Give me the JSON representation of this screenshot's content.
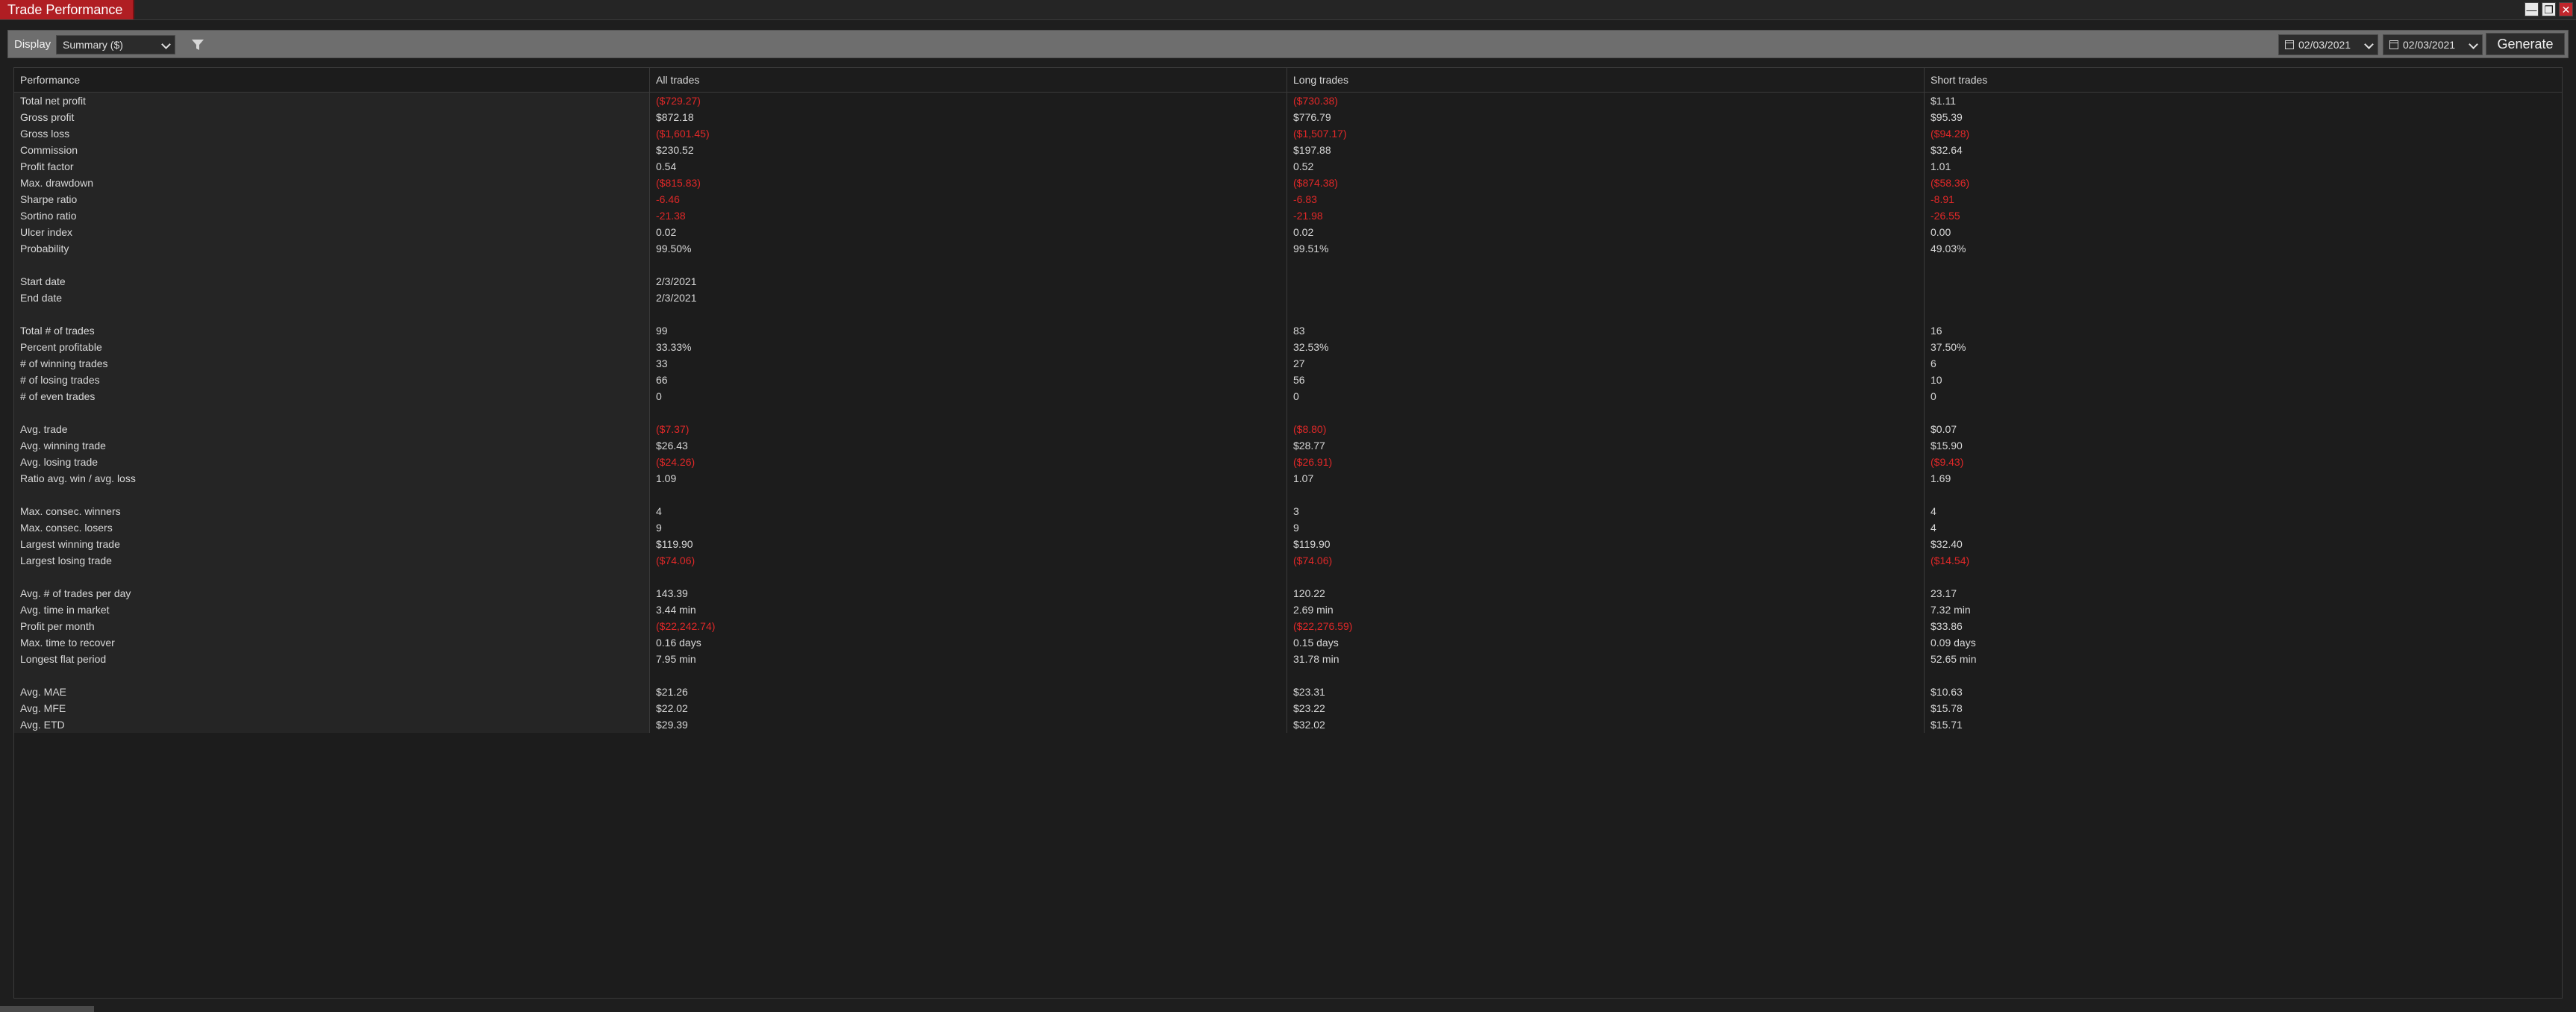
{
  "window": {
    "title": "Trade Performance",
    "controls": {
      "minimize": "—",
      "restore": "❐",
      "close": "✕"
    }
  },
  "toolbar": {
    "display_label": "Display",
    "display_value": "Summary ($)",
    "from_date": "02/03/2021",
    "to_date": "02/03/2021",
    "generate_label": "Generate"
  },
  "colors": {
    "accent": "#b01e23",
    "negative": "#e02828",
    "background": "#1e1e1e"
  },
  "table": {
    "columns": [
      "Performance",
      "All trades",
      "Long trades",
      "Short trades"
    ],
    "rows": [
      {
        "label": "Total net profit",
        "values": [
          "($729.27)",
          "($730.38)",
          "$1.11"
        ],
        "neg": [
          true,
          true,
          false
        ]
      },
      {
        "label": "Gross profit",
        "values": [
          "$872.18",
          "$776.79",
          "$95.39"
        ],
        "neg": [
          false,
          false,
          false
        ]
      },
      {
        "label": "Gross loss",
        "values": [
          "($1,601.45)",
          "($1,507.17)",
          "($94.28)"
        ],
        "neg": [
          true,
          true,
          true
        ]
      },
      {
        "label": "Commission",
        "values": [
          "$230.52",
          "$197.88",
          "$32.64"
        ],
        "neg": [
          false,
          false,
          false
        ]
      },
      {
        "label": "Profit factor",
        "values": [
          "0.54",
          "0.52",
          "1.01"
        ],
        "neg": [
          false,
          false,
          false
        ]
      },
      {
        "label": "Max. drawdown",
        "values": [
          "($815.83)",
          "($874.38)",
          "($58.36)"
        ],
        "neg": [
          true,
          true,
          true
        ]
      },
      {
        "label": "Sharpe ratio",
        "values": [
          "-6.46",
          "-6.83",
          "-8.91"
        ],
        "neg": [
          true,
          true,
          true
        ]
      },
      {
        "label": "Sortino ratio",
        "values": [
          "-21.38",
          "-21.98",
          "-26.55"
        ],
        "neg": [
          true,
          true,
          true
        ]
      },
      {
        "label": "Ulcer index",
        "values": [
          "0.02",
          "0.02",
          "0.00"
        ],
        "neg": [
          false,
          false,
          false
        ]
      },
      {
        "label": "Probability",
        "values": [
          "99.50%",
          "99.51%",
          "49.03%"
        ],
        "neg": [
          false,
          false,
          false
        ]
      },
      {
        "label": "",
        "values": [
          "",
          "",
          ""
        ],
        "neg": [
          false,
          false,
          false
        ]
      },
      {
        "label": "Start date",
        "values": [
          "2/3/2021",
          "",
          ""
        ],
        "neg": [
          false,
          false,
          false
        ]
      },
      {
        "label": "End date",
        "values": [
          "2/3/2021",
          "",
          ""
        ],
        "neg": [
          false,
          false,
          false
        ]
      },
      {
        "label": "",
        "values": [
          "",
          "",
          ""
        ],
        "neg": [
          false,
          false,
          false
        ]
      },
      {
        "label": "Total # of trades",
        "values": [
          "99",
          "83",
          "16"
        ],
        "neg": [
          false,
          false,
          false
        ]
      },
      {
        "label": "Percent profitable",
        "values": [
          "33.33%",
          "32.53%",
          "37.50%"
        ],
        "neg": [
          false,
          false,
          false
        ]
      },
      {
        "label": "# of winning trades",
        "values": [
          "33",
          "27",
          "6"
        ],
        "neg": [
          false,
          false,
          false
        ]
      },
      {
        "label": "# of losing trades",
        "values": [
          "66",
          "56",
          "10"
        ],
        "neg": [
          false,
          false,
          false
        ]
      },
      {
        "label": "# of even trades",
        "values": [
          "0",
          "0",
          "0"
        ],
        "neg": [
          false,
          false,
          false
        ]
      },
      {
        "label": "",
        "values": [
          "",
          "",
          ""
        ],
        "neg": [
          false,
          false,
          false
        ]
      },
      {
        "label": "Avg. trade",
        "values": [
          "($7.37)",
          "($8.80)",
          "$0.07"
        ],
        "neg": [
          true,
          true,
          false
        ]
      },
      {
        "label": "Avg. winning trade",
        "values": [
          "$26.43",
          "$28.77",
          "$15.90"
        ],
        "neg": [
          false,
          false,
          false
        ]
      },
      {
        "label": "Avg. losing trade",
        "values": [
          "($24.26)",
          "($26.91)",
          "($9.43)"
        ],
        "neg": [
          true,
          true,
          true
        ]
      },
      {
        "label": "Ratio avg. win / avg. loss",
        "values": [
          "1.09",
          "1.07",
          "1.69"
        ],
        "neg": [
          false,
          false,
          false
        ]
      },
      {
        "label": "",
        "values": [
          "",
          "",
          ""
        ],
        "neg": [
          false,
          false,
          false
        ]
      },
      {
        "label": "Max. consec. winners",
        "values": [
          "4",
          "3",
          "4"
        ],
        "neg": [
          false,
          false,
          false
        ]
      },
      {
        "label": "Max. consec. losers",
        "values": [
          "9",
          "9",
          "4"
        ],
        "neg": [
          false,
          false,
          false
        ]
      },
      {
        "label": "Largest winning trade",
        "values": [
          "$119.90",
          "$119.90",
          "$32.40"
        ],
        "neg": [
          false,
          false,
          false
        ]
      },
      {
        "label": "Largest losing trade",
        "values": [
          "($74.06)",
          "($74.06)",
          "($14.54)"
        ],
        "neg": [
          true,
          true,
          true
        ]
      },
      {
        "label": "",
        "values": [
          "",
          "",
          ""
        ],
        "neg": [
          false,
          false,
          false
        ]
      },
      {
        "label": "Avg. # of trades per day",
        "values": [
          "143.39",
          "120.22",
          "23.17"
        ],
        "neg": [
          false,
          false,
          false
        ]
      },
      {
        "label": "Avg. time in market",
        "values": [
          "3.44 min",
          "2.69 min",
          "7.32 min"
        ],
        "neg": [
          false,
          false,
          false
        ]
      },
      {
        "label": "Profit per month",
        "values": [
          "($22,242.74)",
          "($22,276.59)",
          "$33.86"
        ],
        "neg": [
          true,
          true,
          false
        ]
      },
      {
        "label": "Max. time to recover",
        "values": [
          "0.16 days",
          "0.15 days",
          "0.09 days"
        ],
        "neg": [
          false,
          false,
          false
        ]
      },
      {
        "label": "Longest flat period",
        "values": [
          "7.95 min",
          "31.78 min",
          "52.65 min"
        ],
        "neg": [
          false,
          false,
          false
        ]
      },
      {
        "label": "",
        "values": [
          "",
          "",
          ""
        ],
        "neg": [
          false,
          false,
          false
        ]
      },
      {
        "label": "Avg. MAE",
        "values": [
          "$21.26",
          "$23.31",
          "$10.63"
        ],
        "neg": [
          false,
          false,
          false
        ]
      },
      {
        "label": "Avg. MFE",
        "values": [
          "$22.02",
          "$23.22",
          "$15.78"
        ],
        "neg": [
          false,
          false,
          false
        ]
      },
      {
        "label": "Avg. ETD",
        "values": [
          "$29.39",
          "$32.02",
          "$15.71"
        ],
        "neg": [
          false,
          false,
          false
        ]
      }
    ]
  }
}
